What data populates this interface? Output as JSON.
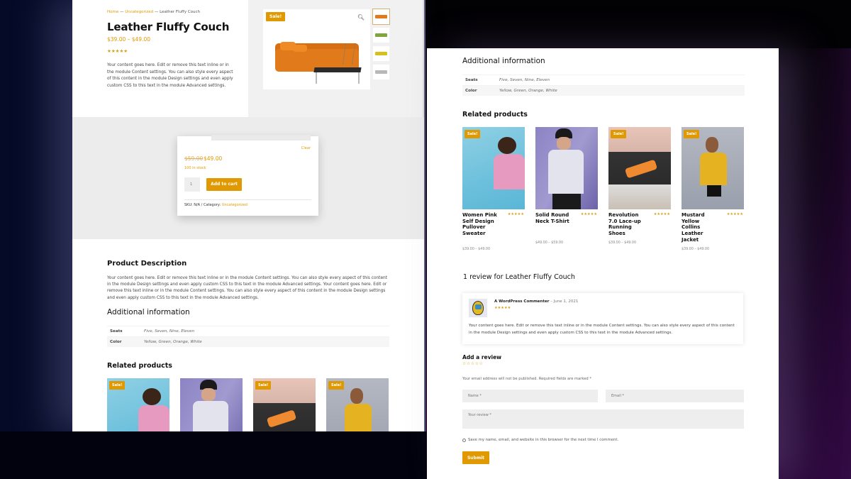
{
  "product": {
    "breadcrumb": {
      "home": "Home",
      "sep1": " — ",
      "category": "Uncategorized",
      "sep2": " — ",
      "current": "Leather Fluffy Couch"
    },
    "title": "Leather Fluffy Couch",
    "price_range": "$39.00 – $49.00",
    "rating_stars": "★★★★★",
    "rating": 5,
    "short_description": "Your content goes here. Edit or remove this text inline or in the module Content settings. You can also style every aspect of this content in the module Design settings and even apply custom CSS to this text in the module Advanced settings.",
    "sale_badge": "Sale!",
    "zoom_icon": "search-icon",
    "thumbnails": [
      {
        "name": "orange-couch",
        "color": "#e07a1a"
      },
      {
        "name": "green-couch",
        "color": "#7fa63a"
      },
      {
        "name": "yellow-couch",
        "color": "#d8c01a"
      },
      {
        "name": "white-couch",
        "color": "#b8b8b8"
      }
    ]
  },
  "cart": {
    "clear_label": "Clear",
    "old_price": "$59.00",
    "new_price": "$49.00",
    "stock": "100 in stock",
    "quantity": "1",
    "add_to_cart_label": "Add to cart",
    "sku_label": "SKU: N/A / Category: ",
    "category_link": "Uncategorized"
  },
  "description": {
    "title": "Product Description",
    "text": "Your content goes here. Edit or remove this text inline or in the module Content settings. You can also style every aspect of this content in the module Design settings and even apply custom CSS to this text in the module Advanced settings. Your content goes here. Edit or remove this text inline or in the module Content settings. You can also style every aspect of this content in the module Design settings and even apply custom CSS to this text in the module Advanced settings."
  },
  "additional_info": {
    "title": "Additional information",
    "rows": [
      {
        "key": "Seats",
        "value": "Five, Seven, Nine, Eleven"
      },
      {
        "key": "Color",
        "value": "Yellow, Green, Orange, White"
      }
    ]
  },
  "related": {
    "title": "Related products",
    "items": [
      {
        "name": "Women Pink Self Design Pullover Sweater",
        "stars": "★★★★★",
        "price": "$39.00 – $49.00",
        "sale": "Sale!"
      },
      {
        "name": "Solid Round Neck T-Shirt",
        "stars": "★★★★★",
        "price": "$49.00 – $59.00",
        "sale": ""
      },
      {
        "name": "Revolution 7.0 Lace-up Running Shoes",
        "stars": "★★★★★",
        "price": "$39.00 – $49.00",
        "sale": "Sale!"
      },
      {
        "name": "Mustard Yellow Collins Leather Jacket",
        "stars": "★★★★★",
        "price": "$39.00 – $49.00",
        "sale": "Sale!"
      }
    ]
  },
  "reviews": {
    "title": "1 review for Leather Fluffy Couch",
    "items": [
      {
        "author": "A WordPress Commenter",
        "date": " – June 1, 2021",
        "stars": "★★★★★",
        "text": "Your content goes here. Edit or remove this text inline or in the module Content settings. You can also style every aspect of this content in the module Design settings and even apply custom CSS to this text in the module Advanced settings."
      }
    ]
  },
  "review_form": {
    "title": "Add a review",
    "empty_stars": "☆☆☆☆☆",
    "note": "Your email address will not be published. Required fields are marked *",
    "name_placeholder": "Name *",
    "email_placeholder": "Email *",
    "review_placeholder": "Your review *",
    "save_label": "Save my name, email, and website in this browser for the next time I comment.",
    "submit_label": "Submit"
  },
  "colors": {
    "accent": "#e09900",
    "star": "#d4a017"
  }
}
